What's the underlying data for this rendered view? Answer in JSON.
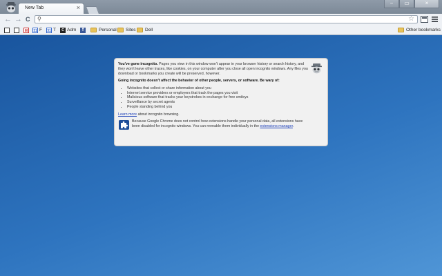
{
  "tab": {
    "title": "New Tab",
    "close_icon": "×"
  },
  "window_controls": {
    "minimize": "−",
    "maximize": "▭",
    "close": "×"
  },
  "toolbar": {
    "back": "←",
    "forward": "→",
    "reload": "C",
    "omnibox_value": ""
  },
  "bookmarks": {
    "items": [
      {
        "label": "",
        "icon": "page-icon"
      },
      {
        "label": "",
        "icon": "page-icon"
      },
      {
        "label": "",
        "icon": "gmail-icon",
        "icon_text": "M"
      },
      {
        "label": "F",
        "icon": "calendar-icon",
        "icon_text": "31"
      },
      {
        "label": "T",
        "icon": "calendar-icon",
        "icon_text": "31"
      },
      {
        "label": "Adm",
        "icon": "admin-icon",
        "icon_text": "C"
      },
      {
        "label": "",
        "icon": "facebook-icon",
        "icon_text": "f"
      },
      {
        "label": "Personal",
        "icon": "folder-icon"
      },
      {
        "label": "Sites",
        "icon": "folder-icon"
      },
      {
        "label": "Dell",
        "icon": "folder-icon"
      }
    ],
    "other": "Other bookmarks"
  },
  "incognito": {
    "intro_bold": "You've gone incognito.",
    "intro_text": " Pages you view in this window won't appear in your browser history or search history, and they won't leave other traces, like cookies, on your computer after you close all open incognito windows. Any files you download or bookmarks you create will be preserved, however.",
    "warning_bold": "Going incognito doesn't affect the behavior of other people, servers, or software. Be wary of:",
    "list": [
      "Websites that collect or share information about you",
      "Internet service providers or employers that track the pages you visit",
      "Malicious software that tracks your keystrokes in exchange for free smileys",
      "Surveillance by secret agents",
      "People standing behind you"
    ],
    "learn_more_link": "Learn more",
    "learn_more_rest": " about incognito browsing.",
    "extensions_text": "Because Google Chrome does not control how extensions handle your personal data, all extensions have been disabled for incognito windows. You can reenable them individually in the ",
    "extensions_link": "extensions manager",
    "extensions_end": "."
  },
  "colors": {
    "background_top": "#19559e",
    "background_bottom": "#4f95d6",
    "card": "#f1f1f1",
    "link": "#1a3eb8"
  }
}
